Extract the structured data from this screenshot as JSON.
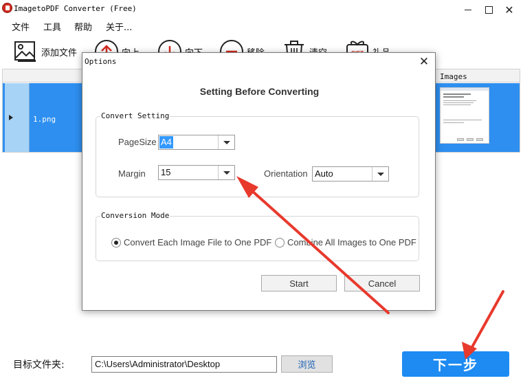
{
  "window": {
    "title": "ImagetoPDF Converter (Free)"
  },
  "menu": {
    "items": [
      "文件",
      "工具",
      "帮助",
      "关于..."
    ]
  },
  "toolbar": {
    "add_files": "添加文件",
    "move_up": "向上",
    "move_down": "向下",
    "remove": "移除",
    "clear": "清空",
    "gift": "礼品",
    "gift_badge": "GIFT"
  },
  "grid": {
    "header_images": "Images",
    "rows": [
      {
        "filename": "1.png"
      }
    ]
  },
  "bottom": {
    "target_label": "目标文件夹:",
    "target_path": "C:\\Users\\Administrator\\Desktop",
    "browse": "浏览",
    "next": "下一步"
  },
  "dialog": {
    "title": "Options",
    "heading": "Setting Before Converting",
    "convert_setting": {
      "title": "Convert Setting",
      "page_size_label": "PageSize",
      "page_size_value": "A4",
      "margin_label": "Margin",
      "margin_value": "15",
      "orientation_label": "Orientation",
      "orientation_value": "Auto"
    },
    "conversion_mode": {
      "title": "Conversion Mode",
      "option_one": "Convert Each Image File to One PDF",
      "option_two": "Combine All Images to One PDF",
      "selected": "option_one"
    },
    "start": "Start",
    "cancel": "Cancel"
  },
  "colors": {
    "selection_blue": "#2e8ff0",
    "next_button": "#1d8bf2",
    "annotation_arrow": "#e8392d"
  }
}
